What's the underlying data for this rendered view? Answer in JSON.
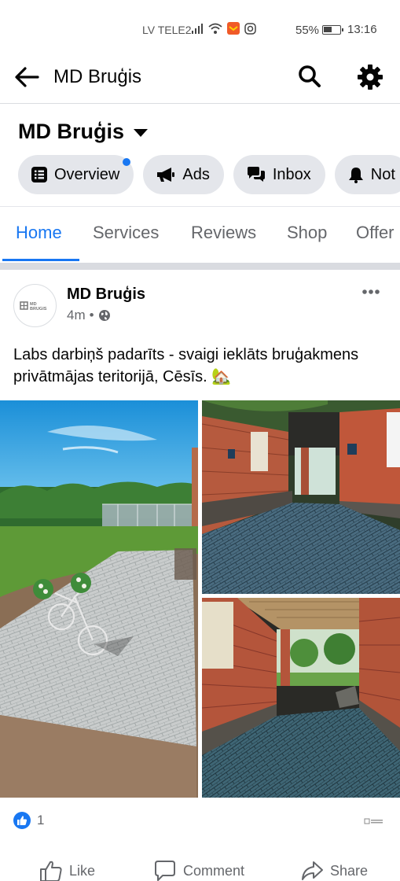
{
  "status_bar": {
    "carrier": "LV TELE2",
    "battery_percent": "55%",
    "battery_level": 0.55,
    "time": "13:16"
  },
  "app_bar": {
    "title": "MD Bruģis"
  },
  "page_header": {
    "name": "MD Bruģis",
    "chips": [
      {
        "label": "Overview",
        "icon": "list-icon",
        "has_notification_dot": true
      },
      {
        "label": "Ads",
        "icon": "megaphone-icon"
      },
      {
        "label": "Inbox",
        "icon": "chat-bubbles-icon"
      },
      {
        "label": "Not",
        "icon": "bell-icon"
      }
    ]
  },
  "tabs": [
    {
      "label": "Home",
      "active": true
    },
    {
      "label": "Services"
    },
    {
      "label": "Reviews"
    },
    {
      "label": "Shop"
    },
    {
      "label": "Offer"
    }
  ],
  "post": {
    "author": "MD Bruģis",
    "avatar_text": "MD BRUGIS",
    "time": "4m",
    "separator": "•",
    "audience_icon": "globe-icon",
    "text": "Labs darbiņš padarīts - svaigi ieklāts bruģakmens privātmājas teritorijā, Cēsīs. 🏡",
    "photos": [
      "garden-paving-bicycle-photo",
      "brick-house-passage-photo",
      "covered-passage-photo"
    ],
    "reactions": {
      "count": "1",
      "type": "like"
    },
    "actions": [
      {
        "label": "Like",
        "icon": "thumbs-up-icon"
      },
      {
        "label": "Comment",
        "icon": "comment-icon"
      },
      {
        "label": "Share",
        "icon": "share-icon"
      }
    ]
  },
  "colors": {
    "accent": "#1877f2",
    "chip_bg": "#e4e6eb",
    "secondary_text": "#65676b"
  }
}
